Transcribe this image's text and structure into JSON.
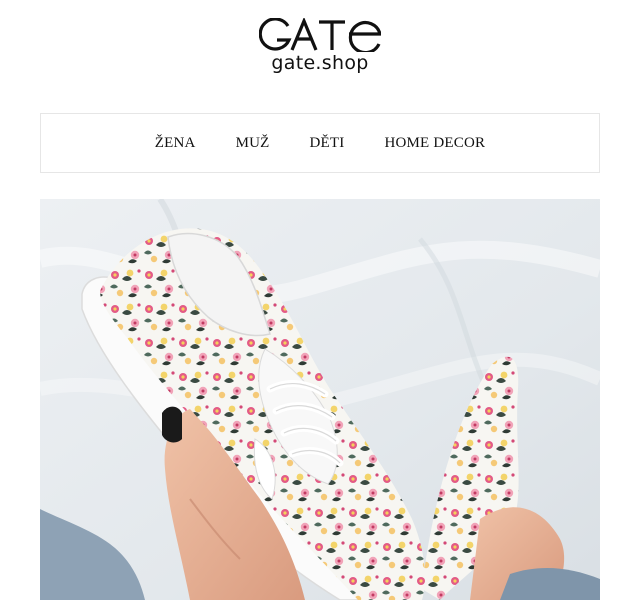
{
  "brand": {
    "logo_text": "GATE",
    "domain": "gate.shop"
  },
  "nav": {
    "items": [
      {
        "label": "ŽENA"
      },
      {
        "label": "MUŽ"
      },
      {
        "label": "DĚTI"
      },
      {
        "label": "HOME DECOR"
      }
    ]
  },
  "colors": {
    "text": "#111111",
    "nav_border": "#e6e6e6",
    "hero_background": "#e9edf1"
  },
  "hero": {
    "image": "floral-sneakers-photo"
  }
}
